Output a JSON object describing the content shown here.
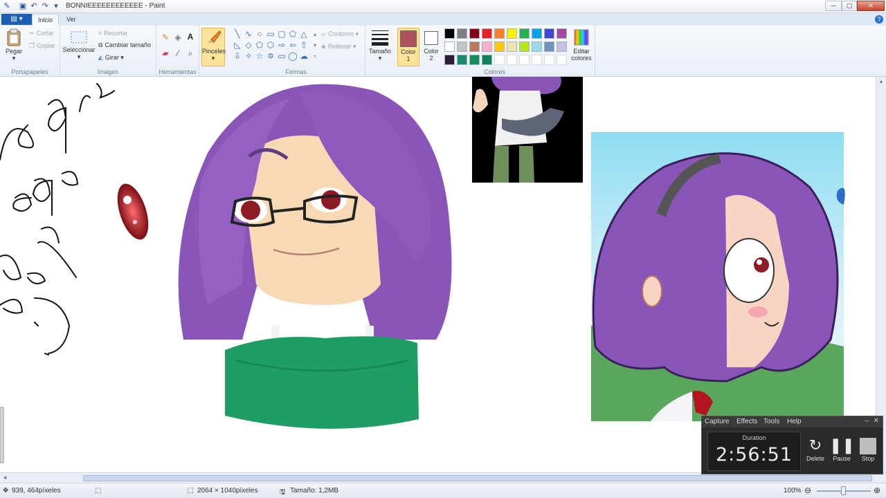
{
  "window": {
    "title": "BONNIEEEEEEEEEEEE - Paint",
    "minimize": "─",
    "maximize": "▢",
    "close": "✕"
  },
  "tabs": {
    "file": "▤ ▾",
    "inicio": "Inicio",
    "ver": "Ver",
    "help": "?"
  },
  "ribbon": {
    "portapapeles": {
      "label": "Portapapeles",
      "pegar": "Pegar",
      "cortar": "Cortar",
      "copiar": "Copiar"
    },
    "imagen": {
      "label": "Imagen",
      "seleccionar": "Seleccionar",
      "recortar": "Recortar",
      "cambiar_tamano": "Cambiar tamaño",
      "girar": "Girar"
    },
    "herramientas": {
      "label": "Herramientas"
    },
    "pinceles": {
      "label": "Pinceles"
    },
    "formas": {
      "label": "Formas",
      "contorno": "Contorno",
      "rellenar": "Rellenar"
    },
    "tamano": {
      "label": "Tamaño"
    },
    "colores": {
      "label": "Colores",
      "color1_line1": "Color",
      "color1_line2": "1",
      "color2_line1": "Color",
      "color2_line2": "2",
      "editar_line1": "Editar",
      "editar_line2": "colores",
      "color1_hex": "#b0525e",
      "color2_hex": "#ffffff",
      "palette": [
        [
          "#000000",
          "#7f7f7f",
          "#880015",
          "#ed1c24",
          "#ff7f27",
          "#fff200",
          "#22b14c",
          "#00a2e8",
          "#3f48cc",
          "#a349a4"
        ],
        [
          "#ffffff",
          "#c3c3c3",
          "#b97a57",
          "#ffaec9",
          "#ffc90e",
          "#efe4b0",
          "#b5e61d",
          "#99d9ea",
          "#7092be",
          "#c8bfe7"
        ],
        [
          "#2b1d33",
          "#1a8a6a",
          "#158a5c",
          "#0f8060",
          "",
          "",
          "",
          "",
          "",
          ""
        ]
      ]
    }
  },
  "status": {
    "cursor": "939, 464píxeles",
    "dimensions": "2064 × 1040píxeles",
    "size": "Tamaño: 1,2MB",
    "zoom": "100%"
  },
  "capture": {
    "menu": [
      "Capture",
      "Effects",
      "Tools",
      "Help"
    ],
    "minimize": "–",
    "close": "✕",
    "duration_label": "Duration",
    "duration": "2:56:51",
    "delete": "Delete",
    "pause": "Pause",
    "stop": "Stop"
  },
  "colors": {
    "hair_purple": "#8a55b8",
    "sweater_green": "#1e9e63",
    "skin": "#f8d9b6",
    "ribbon_accent": "#f5a623"
  }
}
